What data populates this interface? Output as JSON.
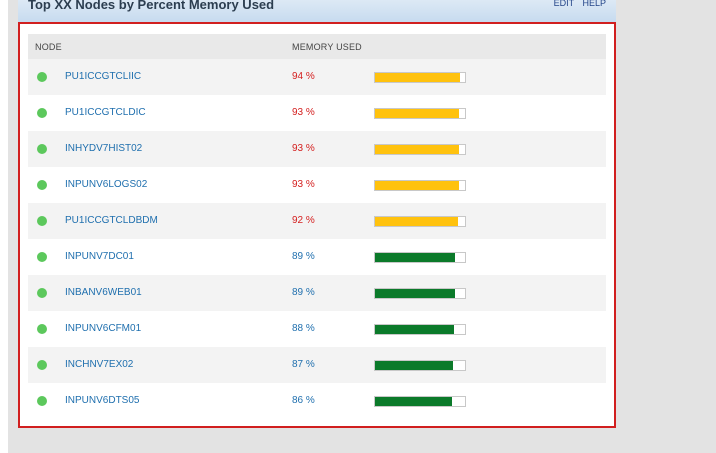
{
  "widget": {
    "title": "Top XX Nodes by Percent Memory Used",
    "links": [
      "EDIT",
      "HELP"
    ]
  },
  "table": {
    "headers": {
      "node": "NODE",
      "memory": "MEMORY USED"
    },
    "rows": [
      {
        "node": "PU1ICCGTCLIIC",
        "pct_text": "94 %",
        "value": 94,
        "status": "warning"
      },
      {
        "node": "PU1ICCGTCLDIC",
        "pct_text": "93 %",
        "value": 93,
        "status": "warning"
      },
      {
        "node": "INHYDV7HIST02",
        "pct_text": "93 %",
        "value": 93,
        "status": "warning"
      },
      {
        "node": "INPUNV6LOGS02",
        "pct_text": "93 %",
        "value": 93,
        "status": "warning"
      },
      {
        "node": "PU1ICCGTCLDBDM",
        "pct_text": "92 %",
        "value": 92,
        "status": "warning"
      },
      {
        "node": "INPUNV7DC01",
        "pct_text": "89 %",
        "value": 89,
        "status": "ok"
      },
      {
        "node": "INBANV6WEB01",
        "pct_text": "89 %",
        "value": 89,
        "status": "ok"
      },
      {
        "node": "INPUNV6CFM01",
        "pct_text": "88 %",
        "value": 88,
        "status": "ok"
      },
      {
        "node": "INCHNV7EX02",
        "pct_text": "87 %",
        "value": 87,
        "status": "ok"
      },
      {
        "node": "INPUNV6DTS05",
        "pct_text": "86 %",
        "value": 86,
        "status": "ok"
      }
    ]
  },
  "colors": {
    "warning_bar": "#ffc20e",
    "warning_text": "#d42020",
    "ok_bar": "#0b7a2a",
    "ok_text": "#1f6fae",
    "status_dot": "#5cc85c",
    "highlight_border": "#d11f1f"
  },
  "icons": {
    "status": "node-status-up-icon"
  }
}
